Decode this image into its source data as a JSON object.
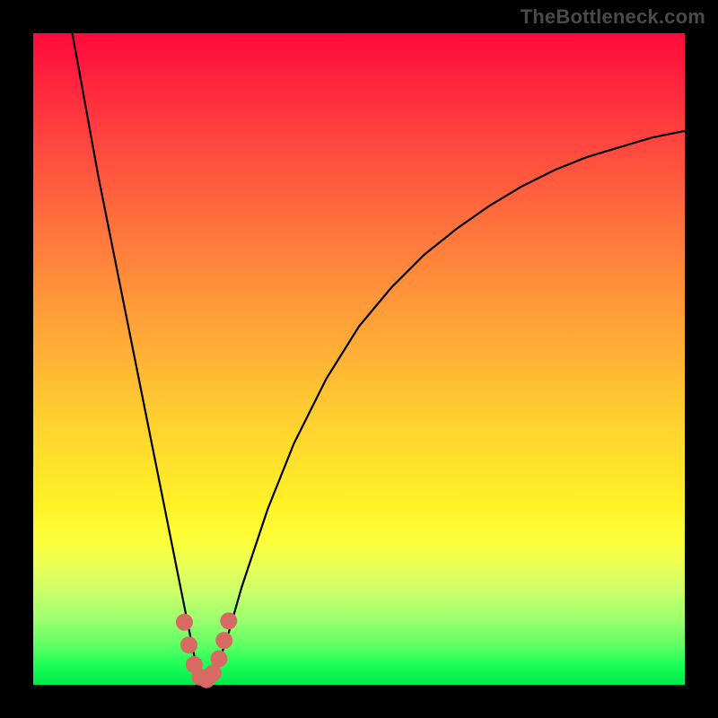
{
  "watermark": "TheBottleneck.com",
  "chart_data": {
    "type": "line",
    "title": "",
    "xlabel": "",
    "ylabel": "",
    "xlim": [
      0,
      100
    ],
    "ylim": [
      0,
      100
    ],
    "series": [
      {
        "name": "curve",
        "x": [
          6,
          8,
          10,
          12,
          14,
          16,
          18,
          20,
          22,
          24,
          25,
          26,
          27,
          28,
          30,
          32,
          36,
          40,
          45,
          50,
          55,
          60,
          65,
          70,
          75,
          80,
          85,
          90,
          95,
          100
        ],
        "y": [
          100,
          89,
          78,
          68,
          58,
          48,
          38,
          28,
          18,
          8,
          3,
          0.5,
          0.5,
          2,
          8,
          15,
          27,
          37,
          47,
          55,
          61,
          66,
          70,
          73.5,
          76.5,
          79,
          81,
          82.5,
          84,
          85
        ]
      }
    ],
    "markers": {
      "name": "valley-markers",
      "color": "#d86a64",
      "points": [
        {
          "x": 23.2,
          "y": 9.6
        },
        {
          "x": 23.9,
          "y": 6.1
        },
        {
          "x": 24.7,
          "y": 3.1
        },
        {
          "x": 25.6,
          "y": 1.2
        },
        {
          "x": 26.6,
          "y": 0.8
        },
        {
          "x": 27.6,
          "y": 1.8
        },
        {
          "x": 28.5,
          "y": 4.0
        },
        {
          "x": 29.3,
          "y": 6.8
        },
        {
          "x": 30.0,
          "y": 9.8
        }
      ]
    },
    "colors": {
      "curve": "#000000",
      "marker": "#d86a64",
      "gradient_top": "#ff0b3a",
      "gradient_bottom": "#00e84a"
    }
  }
}
